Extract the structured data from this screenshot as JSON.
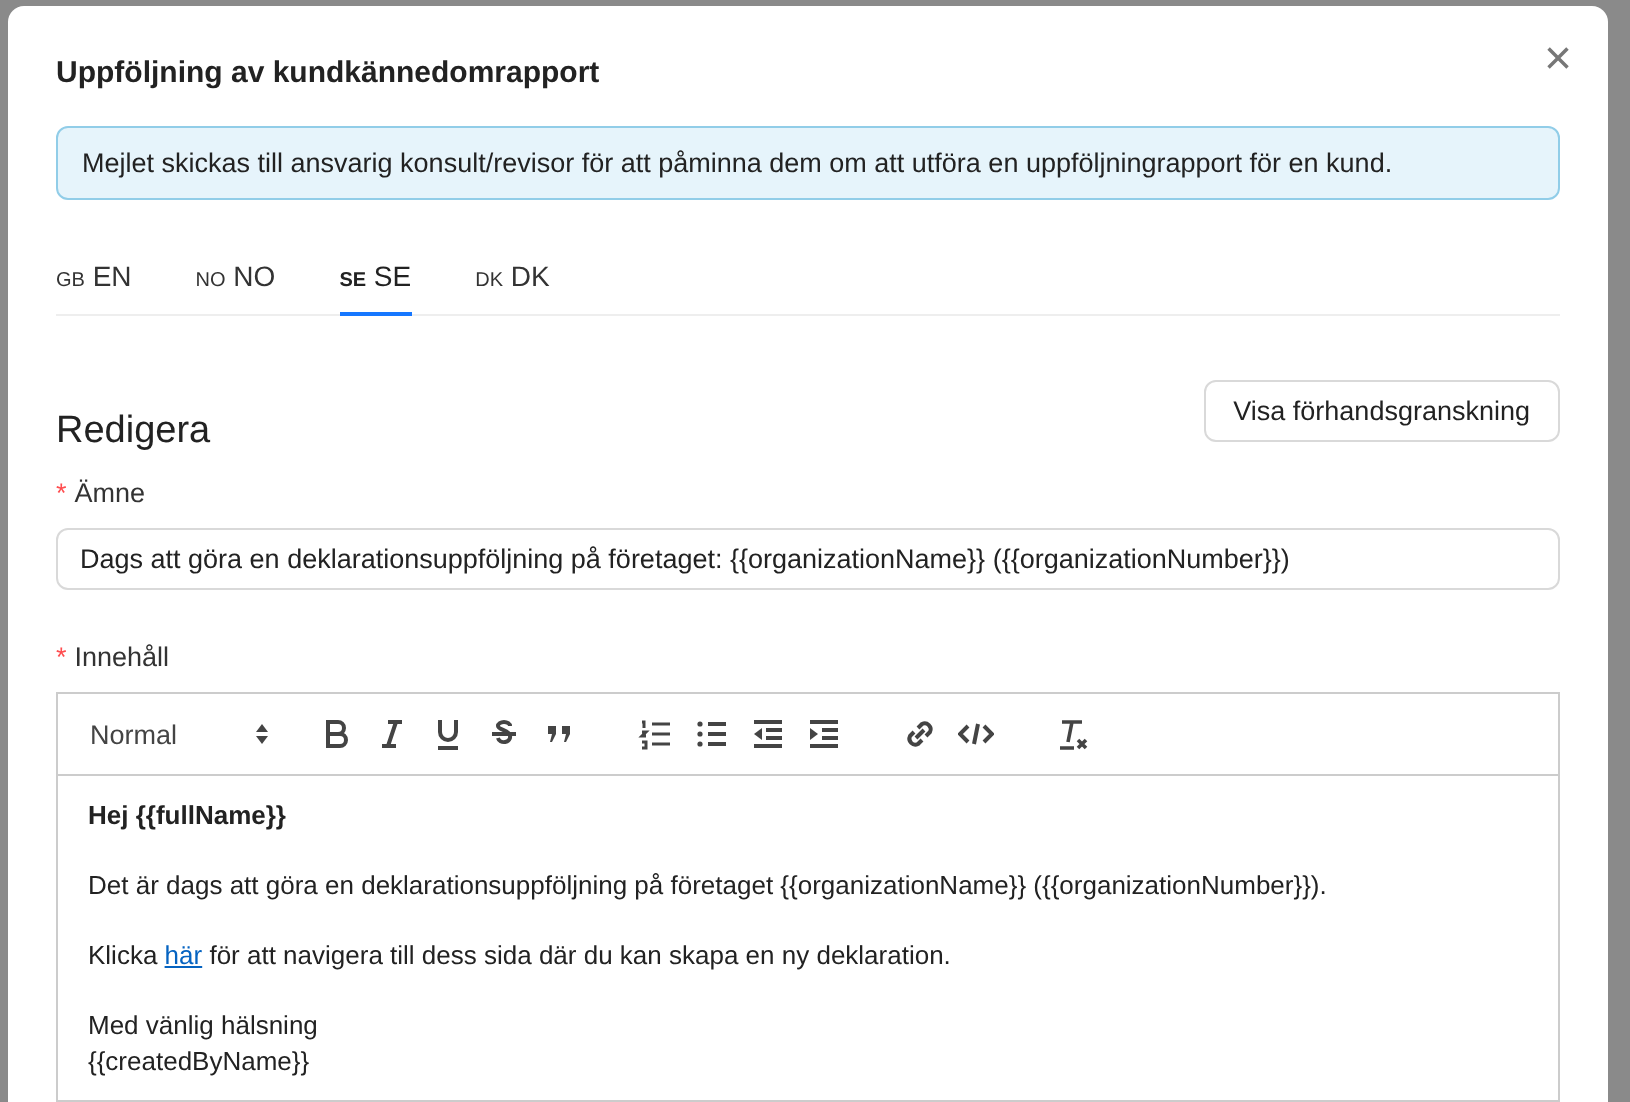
{
  "modal": {
    "title": "Uppföljning av kundkännedomrapport",
    "close": "×",
    "info": "Mejlet skickas till ansvarig konsult/revisor för att påminna dem om att utföra en uppföljningrapport för en kund."
  },
  "tabs": [
    {
      "code": "GB",
      "label": "EN",
      "selected": false
    },
    {
      "code": "NO",
      "label": "NO",
      "selected": false
    },
    {
      "code": "SE",
      "label": "SE",
      "selected": true
    },
    {
      "code": "DK",
      "label": "DK",
      "selected": false
    }
  ],
  "section": {
    "heading": "Redigera",
    "preview_button": "Visa förhandsgranskning"
  },
  "subject": {
    "label": "Ämne",
    "required_mark": "*",
    "value": "Dags att göra en deklarationsuppföljning på företaget: {{organizationName}} ({{organizationNumber}})"
  },
  "content": {
    "label": "Innehåll",
    "required_mark": "*",
    "format": "Normal",
    "paragraphs": [
      {
        "kind": "bold",
        "text": "Hej {{fullName}}"
      },
      {
        "kind": "plain",
        "text": "Det är dags att göra en deklarationsuppföljning på företaget {{organizationName}} ({{organizationNumber}})."
      },
      {
        "kind": "link",
        "before": "Klicka",
        "link": "här",
        "after": "för att navigera till dess sida där du kan skapa en ny deklaration."
      },
      {
        "kind": "lines",
        "lines": [
          "Med vänlig hälsning",
          "{{createdByName}}"
        ]
      }
    ]
  }
}
